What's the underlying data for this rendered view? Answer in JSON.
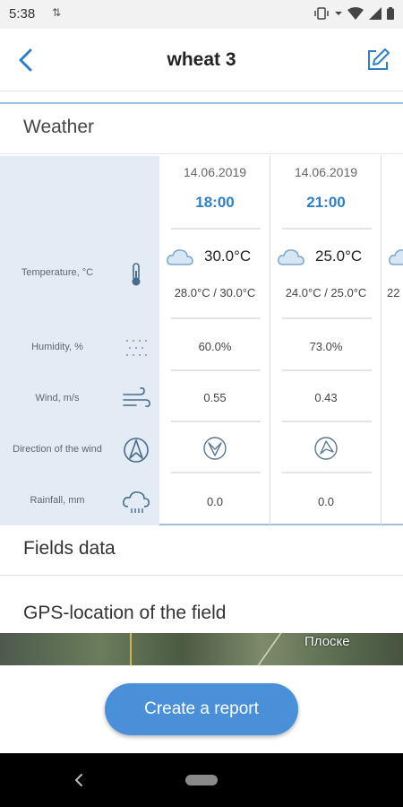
{
  "status_bar": {
    "time": "5:38",
    "sync_arrows": "⇅"
  },
  "header": {
    "title": "wheat 3"
  },
  "weather": {
    "section_title": "Weather",
    "rows": [
      {
        "label": "Temperature, °C"
      },
      {
        "label": "Humidity, %"
      },
      {
        "label": "Wind, m/s"
      },
      {
        "label": "Direction of the wind"
      },
      {
        "label": "Rainfall, mm"
      }
    ],
    "columns": [
      {
        "date": "14.06.2019",
        "time": "18:00",
        "temp": "30.0°C",
        "temp_range": "28.0°C / 30.0°C",
        "humidity": "60.0%",
        "wind": "0.55",
        "rainfall": "0.0"
      },
      {
        "date": "14.06.2019",
        "time": "21:00",
        "temp": "25.0°C",
        "temp_range": "24.0°C / 25.0°C",
        "humidity": "73.0%",
        "wind": "0.43",
        "rainfall": "0.0"
      },
      {
        "temp_range_partial": "22"
      }
    ]
  },
  "fields": {
    "section_title": "Fields data"
  },
  "gps": {
    "title": "GPS-location of the field",
    "map_label": "Плоске"
  },
  "actions": {
    "create_report": "Create a report"
  },
  "colors": {
    "accent": "#2f7fc8",
    "button": "#4a90d9",
    "label_panel": "#e3ecf5"
  }
}
